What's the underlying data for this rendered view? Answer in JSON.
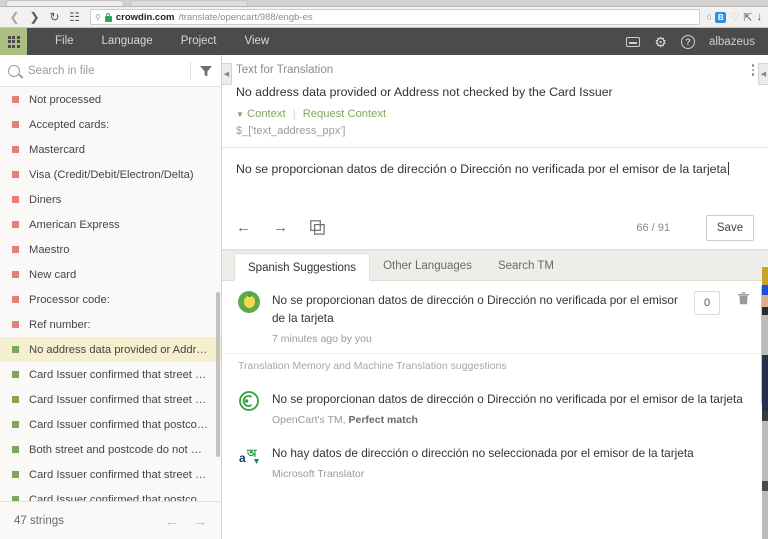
{
  "browser": {
    "url_host": "crowdin.com",
    "url_path": "/translate/opencart/988/engb-es",
    "back_icon": "back-arrow-icon",
    "forward_icon": "forward-arrow-icon",
    "reload_icon": "reload-icon",
    "apps_icon": "apps-grid-icon",
    "search_glyph": "search-icon",
    "ext_badge_count": "0",
    "ext_badge_label": "B",
    "heart_icon": "heart-outline-icon",
    "upload_icon": "upload-icon",
    "download_icon": "download-icon"
  },
  "appbar": {
    "launcher_icon": "apps-grid-icon",
    "menu": [
      {
        "label": "File"
      },
      {
        "label": "Language"
      },
      {
        "label": "Project"
      },
      {
        "label": "View"
      }
    ],
    "keyboard_icon": "keyboard-icon",
    "settings_icon": "gear-icon",
    "help_icon": "help-circle-icon",
    "help_glyph": "?",
    "username": "albazeus"
  },
  "sidebar": {
    "search": {
      "placeholder": "Search in file",
      "value": ""
    },
    "search_icon": "search-icon",
    "filter_icon": "filter-funnel-icon",
    "collapse_icon": "collapse-left-icon",
    "strings": [
      {
        "label": "Not processed",
        "status": "red",
        "selected": false
      },
      {
        "label": "Accepted cards:",
        "status": "red",
        "selected": false
      },
      {
        "label": "Mastercard",
        "status": "red",
        "selected": false
      },
      {
        "label": "Visa (Credit/Debit/Electron/Delta)",
        "status": "red",
        "selected": false
      },
      {
        "label": "Diners",
        "status": "red",
        "selected": false
      },
      {
        "label": "American Express",
        "status": "red",
        "selected": false
      },
      {
        "label": "Maestro",
        "status": "red",
        "selected": false
      },
      {
        "label": "New card",
        "status": "red",
        "selected": false
      },
      {
        "label": "Processor code:",
        "status": "red",
        "selected": false
      },
      {
        "label": "Ref number:",
        "status": "red",
        "selected": false
      },
      {
        "label": "No address data provided or Address...",
        "status": "green",
        "selected": true
      },
      {
        "label": "Card Issuer confirmed that street and...",
        "status": "green",
        "selected": false
      },
      {
        "label": "Card Issuer confirmed that street ma...",
        "status": "green",
        "selected": false
      },
      {
        "label": "Card Issuer confirmed that postcode ...",
        "status": "green",
        "selected": false
      },
      {
        "label": "Both street and postcode do not mat...",
        "status": "green",
        "selected": false
      },
      {
        "label": "Card Issuer confirmed that street ma...",
        "status": "green",
        "selected": false
      },
      {
        "label": "Card Issuer confirmed that postcode ...",
        "status": "green",
        "selected": false
      }
    ],
    "footer": {
      "count_label": "47 strings",
      "prev_icon": "arrow-left-icon",
      "next_icon": "arrow-right-icon"
    }
  },
  "source_panel": {
    "title": "Text for Translation",
    "kebab_icon": "more-options-icon",
    "collapse_icon": "collapse-right-icon",
    "text": "No address data provided or Address not checked by the Card Issuer",
    "context_label": "Context",
    "request_context_label": "Request Context",
    "context_key": "$_['text_address_ppx']"
  },
  "target_panel": {
    "value": "No se proporcionan datos de dirección o Dirección no verificada por el emisor de la tarjeta",
    "prev_icon": "arrow-left-icon",
    "next_icon": "arrow-right-icon",
    "copy_source_icon": "copy-source-icon",
    "char_count": "66 / 91",
    "save_label": "Save"
  },
  "suggestions": {
    "tabs": [
      {
        "label": "Spanish Suggestions",
        "active": true
      },
      {
        "label": "Other Languages",
        "active": false
      },
      {
        "label": "Search TM",
        "active": false
      }
    ],
    "user_suggestion": {
      "avatar_icon": "user-avatar",
      "text": "No se proporcionan datos de dirección o Dirección no verificada por el emisor de la tarjeta",
      "meta": "7 minutes ago by you",
      "votes": "0",
      "delete_icon": "trash-icon"
    },
    "tm_header": "Translation Memory and Machine Translation suggestions",
    "tm_items": [
      {
        "icon": "crowdin-tm-icon",
        "text": "No se proporcionan datos de dirección o Dirección no verificada por el emisor de la tarjeta",
        "source": "OpenCart's TM, ",
        "match": "Perfect match"
      },
      {
        "icon": "microsoft-translator-icon",
        "text": "No hay datos de dirección o dirección no seleccionada por el emisor de la tarjeta",
        "source": "Microsoft Translator",
        "match": ""
      }
    ]
  },
  "colors": {
    "accent_green": "#7fa758",
    "launcher_green": "#abc080",
    "status_red": "#e57f77",
    "status_green": "#7fa758",
    "selected_row": "#f5eecf",
    "appbar": "#4b4b4b"
  }
}
